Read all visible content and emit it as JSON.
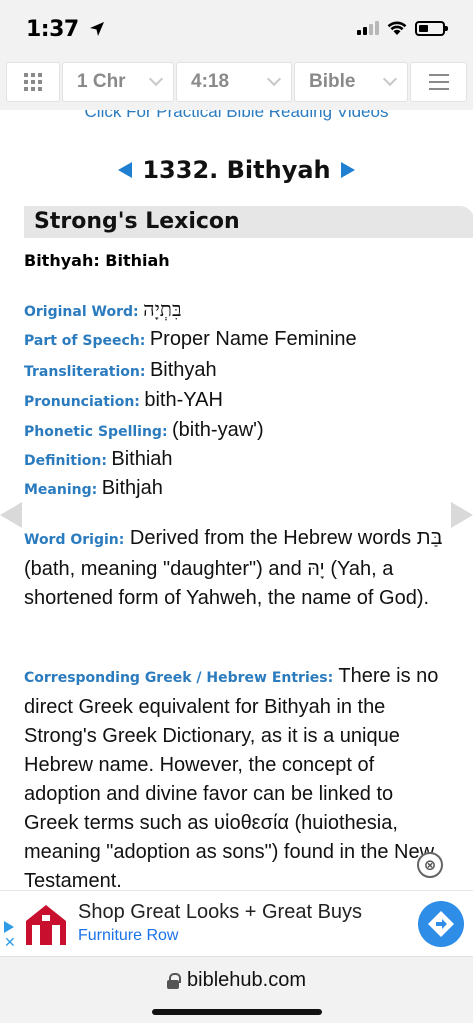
{
  "status_bar": {
    "time": "1:37",
    "icons": [
      "location-arrow-icon",
      "signal-icon",
      "wifi-icon",
      "battery-icon"
    ]
  },
  "toolbar": {
    "book": "1 Chr",
    "chapter": "4:18",
    "version": "Bible",
    "icons": [
      "grid-icon",
      "chevron-down-icon",
      "menu-icon"
    ]
  },
  "content": {
    "promo_link": "Click For Practical Bible Reading Videos",
    "entry_title": "1332. Bithyah",
    "section_header": "Strong's Lexicon",
    "headword": "Bithyah: Bithiah",
    "fields": {
      "original_word": {
        "label": "Original Word:",
        "value": "בִּתְיָה"
      },
      "part_of_speech": {
        "label": "Part of Speech:",
        "value": "Proper Name Feminine"
      },
      "transliteration": {
        "label": "Transliteration:",
        "value": "Bithyah"
      },
      "pronunciation": {
        "label": "Pronunciation:",
        "value": "bith-YAH"
      },
      "phonetic_spelling": {
        "label": "Phonetic Spelling:",
        "value": "(bith-yaw')"
      },
      "definition": {
        "label": "Definition:",
        "value": "Bithiah"
      },
      "meaning": {
        "label": "Meaning:",
        "value": "Bithjah"
      }
    },
    "word_origin": {
      "label": "Word Origin:",
      "text": "Derived from the Hebrew words בַּת (bath, meaning \"daughter\") and יָהּ (Yah, a shortened form of Yahweh, the name of God)."
    },
    "corresponding": {
      "label": "Corresponding Greek / Hebrew Entries:",
      "text": "There is no direct Greek equivalent for Bithyah in the Strong's Greek Dictionary, as it is a unique Hebrew name. However, the concept of adoption and divine favor can be linked to Greek terms such as υἱοθεσία (huiothesia, meaning \"adoption as sons\") found in the New Testament."
    }
  },
  "ad": {
    "title": "Shop Great Looks + Great Buys",
    "advertiser": "Furniture Row",
    "close_symbol": "⊗",
    "x_symbol": "✕",
    "icons": [
      "adchoices-icon",
      "ad-logo-icon",
      "directions-arrow-icon",
      "close-icon"
    ]
  },
  "address_bar": {
    "url": "biblehub.com",
    "icons": [
      "lock-icon"
    ]
  },
  "colors": {
    "link_blue": "#2b7bbf",
    "nav_blue": "#1f7fd0",
    "ad_blue": "#2e8de6",
    "toolbar_bg": "#f2f2f2",
    "header_bg": "#e6e6e6"
  }
}
